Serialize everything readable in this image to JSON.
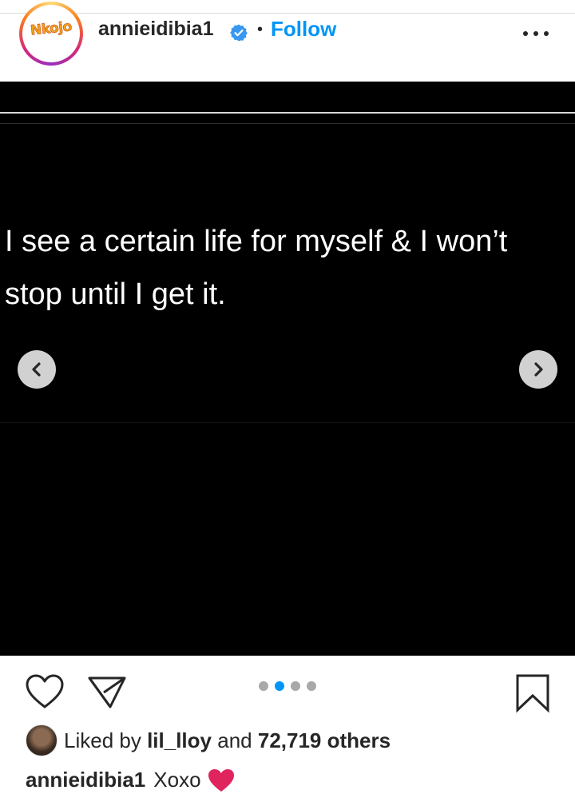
{
  "header": {
    "avatar_logo_text": "Nkojo",
    "username": "annieidibia1",
    "verified_icon": "verified-badge-icon",
    "separator": "•",
    "follow_label": "Follow",
    "more_icon": "more-options-icon"
  },
  "post": {
    "quote_line1": "I see a certain life for myself & I won’t",
    "quote_line2": "stop until I get it.",
    "prev_icon": "chevron-left-icon",
    "next_icon": "chevron-right-icon",
    "carousel": {
      "count": 4,
      "active_index": 1
    }
  },
  "actions": {
    "like_icon": "heart-icon",
    "share_icon": "send-icon",
    "save_icon": "bookmark-icon"
  },
  "likes": {
    "prefix": "Liked by",
    "liker": "lil_lloy",
    "conjunction": "and",
    "others": "72,719 others"
  },
  "caption": {
    "username": "annieidibia1",
    "text": "Xoxo",
    "emoji_icon": "red-heart-icon"
  },
  "colors": {
    "accent_blue": "#0095f6",
    "text": "#262626",
    "media_bg": "#000000",
    "heart_red": "#e0245e"
  }
}
